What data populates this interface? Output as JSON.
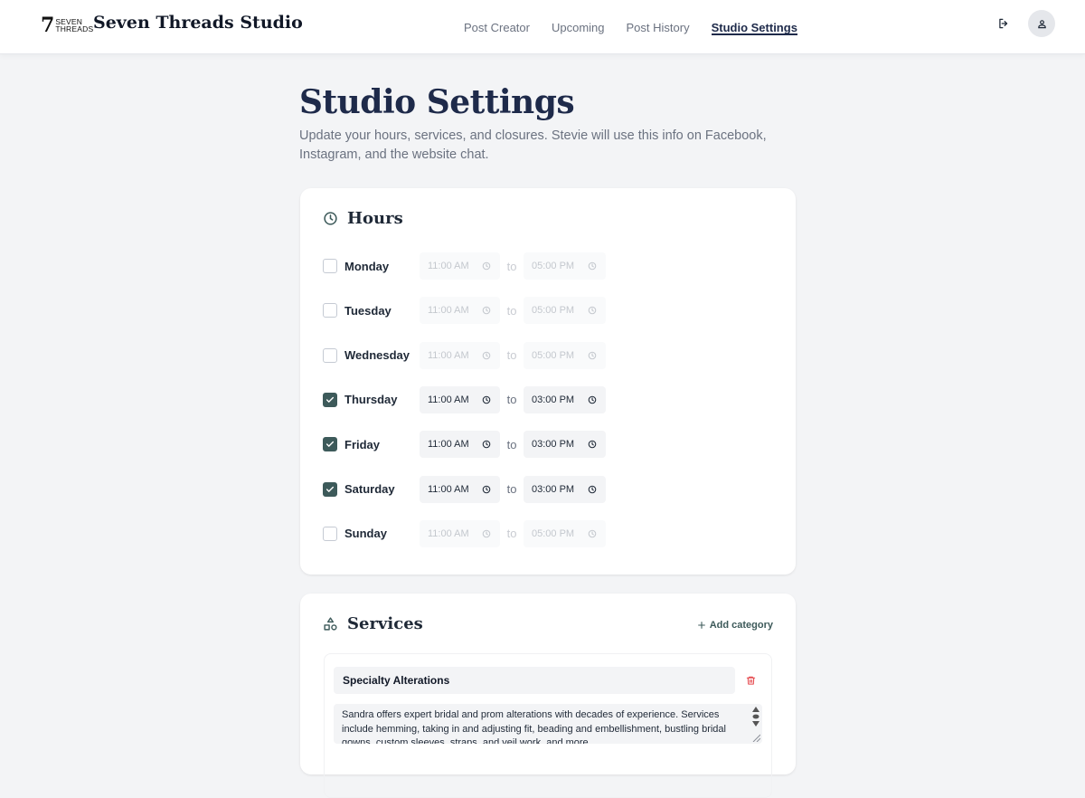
{
  "brand": {
    "logo_numeral": "7",
    "logo_line1": "SEVEN",
    "logo_line2": "THREADS",
    "name": "Seven Threads Studio"
  },
  "nav": {
    "tabs": [
      {
        "label": "Post Creator",
        "active": false
      },
      {
        "label": "Upcoming",
        "active": false
      },
      {
        "label": "Post History",
        "active": false
      },
      {
        "label": "Studio Settings",
        "active": true
      }
    ]
  },
  "header_icons": {
    "logout": "logout-icon",
    "user": "user-icon"
  },
  "page": {
    "title": "Studio Settings",
    "subtitle": "Update your hours, services, and closures. Stevie will use this info on Facebook, Instagram, and the website chat."
  },
  "hours": {
    "title": "Hours",
    "icon": "clock-icon",
    "to_label": "to",
    "days": [
      {
        "name": "Monday",
        "enabled": false,
        "open": "11:00 AM",
        "close": "05:00 PM"
      },
      {
        "name": "Tuesday",
        "enabled": false,
        "open": "11:00 AM",
        "close": "05:00 PM"
      },
      {
        "name": "Wednesday",
        "enabled": false,
        "open": "11:00 AM",
        "close": "05:00 PM"
      },
      {
        "name": "Thursday",
        "enabled": true,
        "open": "11:00 AM",
        "close": "03:00 PM"
      },
      {
        "name": "Friday",
        "enabled": true,
        "open": "11:00 AM",
        "close": "03:00 PM"
      },
      {
        "name": "Saturday",
        "enabled": true,
        "open": "11:00 AM",
        "close": "03:00 PM"
      },
      {
        "name": "Sunday",
        "enabled": false,
        "open": "11:00 AM",
        "close": "05:00 PM"
      }
    ]
  },
  "services": {
    "title": "Services",
    "icon": "shapes-icon",
    "add_category_label": "Add category",
    "categories": [
      {
        "name": "Specialty Alterations",
        "description": "Sandra offers expert bridal and prom alterations with decades of experience. Services include hemming, taking in and adjusting fit, beading and embellishment, bustling bridal gowns, custom sleeves, straps, and veil work, and more."
      }
    ]
  },
  "colors": {
    "navy": "#1e2a4a",
    "accent": "#3d5a5a",
    "danger": "#e5484d",
    "page_bg": "#f3f4f6"
  }
}
